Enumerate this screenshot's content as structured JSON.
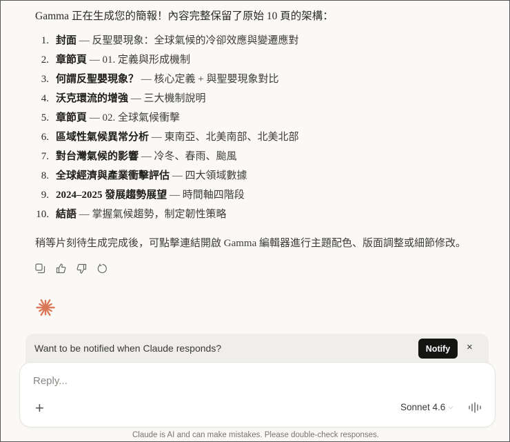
{
  "message": {
    "intro": "Gamma 正在生成您的簡報！內容完整保留了原始 10 頁的架構：",
    "items": [
      {
        "num": "1.",
        "title": "封面",
        "desc": " — 反聖嬰現象：全球氣候的冷卻效應與變遷應對"
      },
      {
        "num": "2.",
        "title": "章節頁",
        "desc": " — 01. 定義與形成機制"
      },
      {
        "num": "3.",
        "title": "何謂反聖嬰現象？",
        "desc": " — 核心定義 + 與聖嬰現象對比"
      },
      {
        "num": "4.",
        "title": "沃克環流的增強",
        "desc": " — 三大機制說明"
      },
      {
        "num": "5.",
        "title": "章節頁",
        "desc": " — 02. 全球氣候衝擊"
      },
      {
        "num": "6.",
        "title": "區域性氣候異常分析",
        "desc": " — 東南亞、北美南部、北美北部"
      },
      {
        "num": "7.",
        "title": "對台灣氣候的影響",
        "desc": " — 冷冬、春雨、颱風"
      },
      {
        "num": "8.",
        "title": "全球經濟與產業衝擊評估",
        "desc": " — 四大領域數據"
      },
      {
        "num": "9.",
        "title": "2024–2025 發展趨勢展望",
        "desc": " — 時間軸四階段"
      },
      {
        "num": "10.",
        "title": "結語",
        "desc": " — 掌握氣候趨勢，制定韌性策略"
      }
    ],
    "outro": "稍等片刻待生成完成後，可點擊連結開啟 Gamma 編輯器進行主題配色、版面調整或細節修改。"
  },
  "banner": {
    "text": "Want to be notified when Claude responds?",
    "notify_label": "Notify",
    "close_label": "×"
  },
  "composer": {
    "placeholder": "Reply...",
    "add_label": "+",
    "model": "Sonnet 4.6",
    "model_chevron": "⌵"
  },
  "footer": "Claude is AI and can make mistakes. Please double-check responses.",
  "colors": {
    "accent": "#d97757",
    "button": "#141413"
  }
}
